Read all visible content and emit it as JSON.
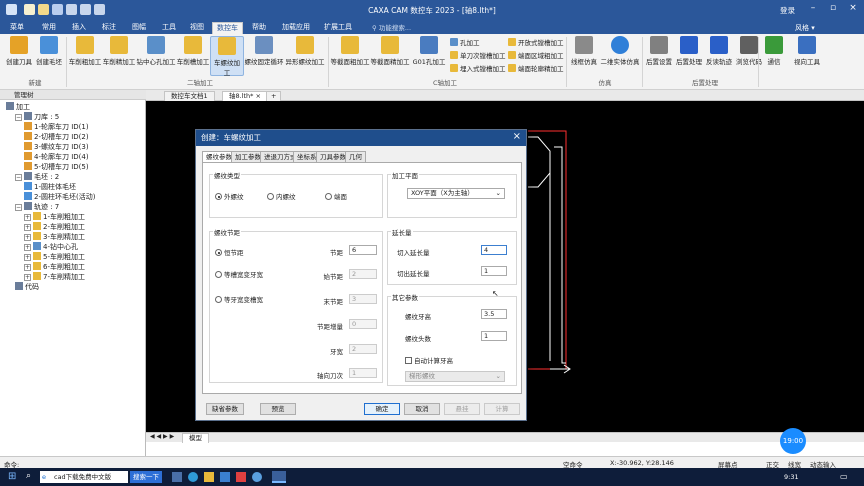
{
  "app": {
    "title": "CAXA CAM 数控车 2023 - [轴8.lth*]",
    "login": "登录"
  },
  "menu": [
    "菜单",
    "常用",
    "插入",
    "标注",
    "图幅",
    "工具",
    "视图",
    "数控车",
    "帮助",
    "加载应用",
    "扩展工具"
  ],
  "menu_active": 7,
  "search_placeholder": "功能搜索...",
  "style_label": "风格",
  "ribbon": {
    "buttons": [
      {
        "label": "创建刀具",
        "icon_color": "#e5a227"
      },
      {
        "label": "创建毛坯",
        "icon_color": "#4a90d9"
      },
      {
        "label": "车削粗加工",
        "icon_color": "#e8b93a"
      },
      {
        "label": "车削精加工",
        "icon_color": "#e8b93a"
      },
      {
        "label": "钻中心孔加工",
        "icon_color": "#5a8fc9"
      },
      {
        "label": "车削槽加工",
        "icon_color": "#e8b93a"
      },
      {
        "label": "车螺纹加工",
        "icon_color": "#e8b93a"
      },
      {
        "label": "螺纹固定循环",
        "icon_color": "#6b8fc0"
      },
      {
        "label": "异形螺纹加工",
        "icon_color": "#e8b93a"
      },
      {
        "label": "等截面粗加工",
        "icon_color": "#e8b93a"
      },
      {
        "label": "等截面精加工",
        "icon_color": "#e8b93a"
      },
      {
        "label": "G01孔加工",
        "icon_color": "#4a7cc0"
      },
      {
        "label": "线框仿真",
        "icon_color": "#8a8a8a"
      },
      {
        "label": "二维实体仿真",
        "icon_color": "#2f7fd8"
      },
      {
        "label": "后置设置",
        "icon_color": "#808080"
      },
      {
        "label": "后置处理",
        "icon_color": "#2a5fc8"
      },
      {
        "label": "反读轨迹",
        "icon_color": "#2a5fc8"
      },
      {
        "label": "浏览代码",
        "icon_color": "#606060"
      },
      {
        "label": "通信",
        "icon_color": "#3a9a3a"
      },
      {
        "label": "视向工具",
        "icon_color": "#3a6fc0"
      }
    ],
    "active_button": 6,
    "small_buttons": [
      "孔加工",
      "单刀次镗槽加工",
      "埋入式镗槽加工",
      "开放式镗槽加工",
      "端面区域粗加工",
      "端面轮廓精加工"
    ],
    "groups": [
      "新建",
      "二轴加工",
      "C轴加工",
      "仿真",
      "后置处理"
    ]
  },
  "tree": {
    "header": "管理树",
    "items": [
      {
        "text": "加工",
        "level": 0,
        "toggle": "",
        "icon": "#6a7d9a"
      },
      {
        "text": "刀库 : 5",
        "level": 1,
        "toggle": "−",
        "icon": "#6a7d9a"
      },
      {
        "text": "1-轮廓车刀 ID(1)",
        "level": 2,
        "toggle": "",
        "icon": "#e09a30"
      },
      {
        "text": "2-切槽车刀 ID(2)",
        "level": 2,
        "toggle": "",
        "icon": "#e09a30"
      },
      {
        "text": "3-螺纹车刀 ID(3)",
        "level": 2,
        "toggle": "",
        "icon": "#e09a30"
      },
      {
        "text": "4-轮廓车刀 ID(4)",
        "level": 2,
        "toggle": "",
        "icon": "#e09a30"
      },
      {
        "text": "5-切槽车刀 ID(5)",
        "level": 2,
        "toggle": "",
        "icon": "#e09a30"
      },
      {
        "text": "毛坯 : 2",
        "level": 1,
        "toggle": "−",
        "icon": "#6a7d9a"
      },
      {
        "text": "1-圆柱体毛坯",
        "level": 2,
        "toggle": "",
        "icon": "#4a90d9"
      },
      {
        "text": "2-圆柱环毛坯(活动)",
        "level": 2,
        "toggle": "",
        "icon": "#4a90d9"
      },
      {
        "text": "轨迹 : 7",
        "level": 1,
        "toggle": "−",
        "icon": "#6a7d9a"
      },
      {
        "text": "1-车削粗加工",
        "level": 2,
        "toggle": "+",
        "icon": "#e8b93a"
      },
      {
        "text": "2-车削粗加工",
        "level": 2,
        "toggle": "+",
        "icon": "#e8b93a"
      },
      {
        "text": "3-车削精加工",
        "level": 2,
        "toggle": "+",
        "icon": "#e8b93a"
      },
      {
        "text": "4-钻中心孔",
        "level": 2,
        "toggle": "+",
        "icon": "#5a8fc9"
      },
      {
        "text": "5-车削粗加工",
        "level": 2,
        "toggle": "+",
        "icon": "#e8b93a"
      },
      {
        "text": "6-车削粗加工",
        "level": 2,
        "toggle": "+",
        "icon": "#e8b93a"
      },
      {
        "text": "7-车削精加工",
        "level": 2,
        "toggle": "+",
        "icon": "#e8b93a"
      },
      {
        "text": "代码",
        "level": 1,
        "toggle": "",
        "icon": "#6a7d9a"
      }
    ]
  },
  "doc_tabs": [
    "数控车文档1",
    "轴8.lth*"
  ],
  "doc_tab_active": 1,
  "bottom_tab": "模型",
  "dialog": {
    "title": "创建：车螺纹加工",
    "tabs": [
      "螺纹参数",
      "加工参数",
      "进退刀方式",
      "坐标系",
      "刀具参数",
      "几何"
    ],
    "active_tab": 0,
    "thread_type": {
      "label": "螺纹类型",
      "options": [
        "外螺纹",
        "内螺纹",
        "端面"
      ],
      "selected": 0
    },
    "plane": {
      "label": "加工平面",
      "value": "XOY平面（X为主轴）"
    },
    "pitch": {
      "label": "螺纹节距",
      "options": [
        "恒节距",
        "等槽宽变牙宽",
        "等牙宽变槽宽"
      ],
      "selected": 0,
      "fields": [
        {
          "label": "节距",
          "value": "6",
          "disabled": false
        },
        {
          "label": "始节距",
          "value": "2",
          "disabled": true
        },
        {
          "label": "末节距",
          "value": "3",
          "disabled": true
        },
        {
          "label": "节距增量",
          "value": "0",
          "disabled": true
        },
        {
          "label": "牙宽",
          "value": "2",
          "disabled": true
        },
        {
          "label": "轴向刀次",
          "value": "1",
          "disabled": true
        }
      ]
    },
    "extend": {
      "label": "延长量",
      "fields": [
        {
          "label": "切入延长量",
          "value": "4"
        },
        {
          "label": "切出延长量",
          "value": "1"
        }
      ]
    },
    "other": {
      "label": "其它参数",
      "fields": [
        {
          "label": "螺纹牙高",
          "value": "3.5"
        },
        {
          "label": "螺纹头数",
          "value": "1"
        }
      ],
      "checkbox": "自动计算牙高",
      "combo": "梯形螺纹"
    },
    "buttons": [
      "缺省参数",
      "预览",
      "确定",
      "取消",
      "悬挂",
      "计算"
    ]
  },
  "command": {
    "prompt": "命令:",
    "status": "空命令",
    "coords": "X:-30.962, Y:28.146",
    "right": [
      "屏幕点",
      "正交",
      "线宽",
      "动态输入"
    ]
  },
  "badge": "19:00",
  "taskbar": {
    "search": "cad下载免费中文版",
    "search_btn": "搜索一下",
    "time": "9:31"
  }
}
